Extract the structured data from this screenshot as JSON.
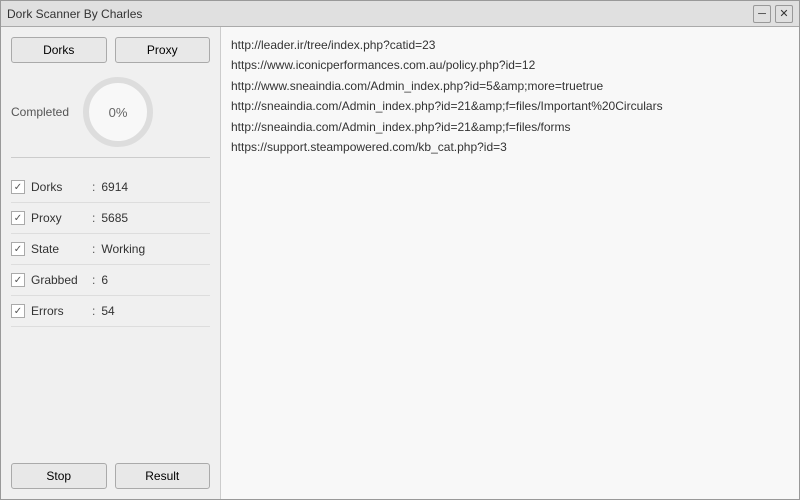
{
  "window": {
    "title": "Dork Scanner By Charles",
    "controls": {
      "minimize": "─",
      "close": "✕"
    }
  },
  "left_panel": {
    "btn_dorks": "Dorks",
    "btn_proxy": "Proxy",
    "progress_label": "Completed",
    "progress_value": "0%",
    "stats": [
      {
        "id": "dorks",
        "name": "Dorks",
        "value": "6914",
        "checked": true
      },
      {
        "id": "proxy",
        "name": "Proxy",
        "value": "5685",
        "checked": true
      },
      {
        "id": "state",
        "name": "State",
        "value": "Working",
        "checked": true
      },
      {
        "id": "grabbed",
        "name": "Grabbed",
        "value": "6",
        "checked": true
      },
      {
        "id": "errors",
        "name": "Errors",
        "value": "54",
        "checked": true
      }
    ],
    "btn_stop": "Stop",
    "btn_result": "Result"
  },
  "right_panel": {
    "urls": [
      "http://leader.ir/tree/index.php?catid=23",
      "https://www.iconicperformances.com.au/policy.php?id=12",
      "http://www.sneaindia.com/Admin_index.php?id=5&amp;more=truetrue",
      "http://sneaindia.com/Admin_index.php?id=21&amp;f=files/Important%20Circulars",
      "http://sneaindia.com/Admin_index.php?id=21&amp;f=files/forms",
      "https://support.steampowered.com/kb_cat.php?id=3"
    ]
  }
}
